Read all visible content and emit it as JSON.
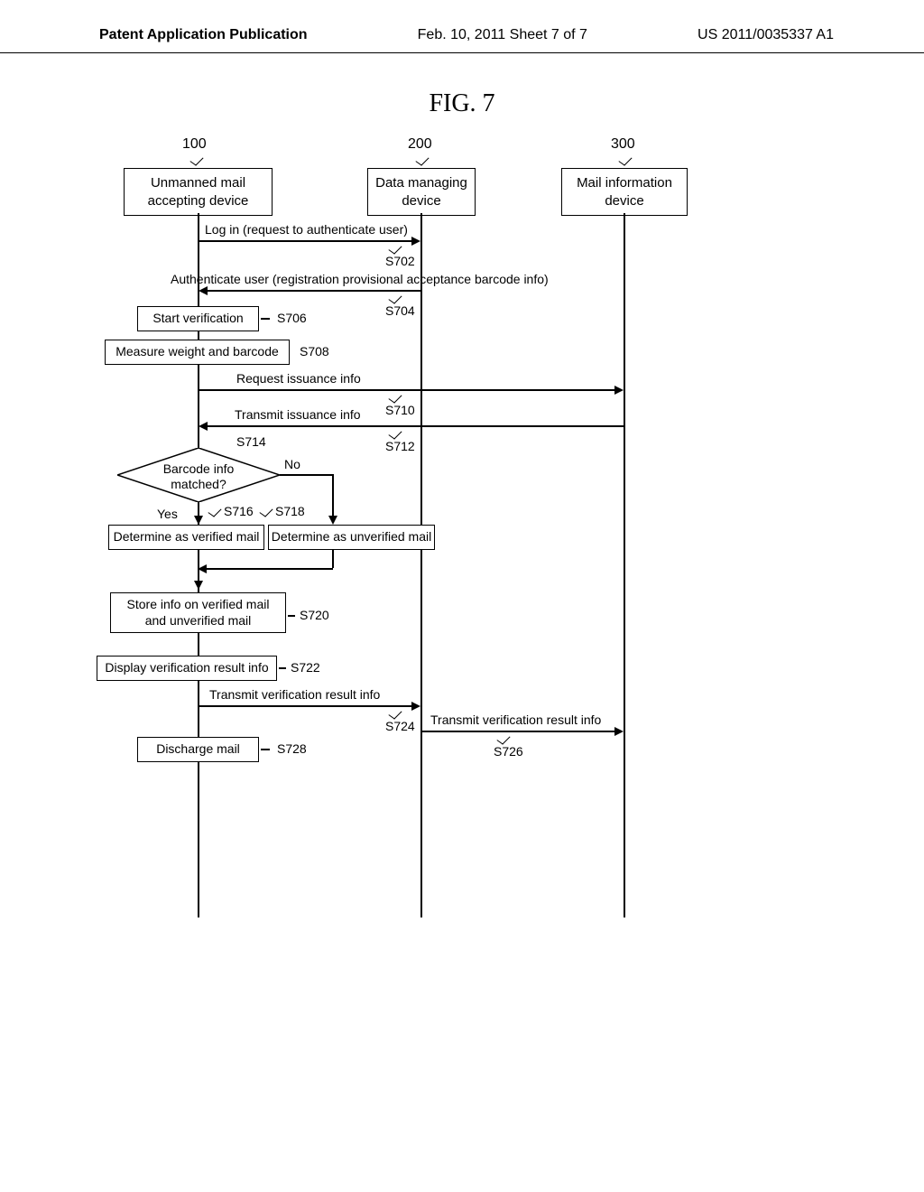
{
  "header": {
    "left": "Patent Application Publication",
    "middle": "Feb. 10, 2011  Sheet 7 of 7",
    "right": "US 2011/0035337 A1"
  },
  "figure_title": "FIG. 7",
  "columns": {
    "c100": {
      "num": "100",
      "label": "Unmanned mail\naccepting device"
    },
    "c200": {
      "num": "200",
      "label": "Data managing\ndevice"
    },
    "c300": {
      "num": "300",
      "label": "Mail information\ndevice"
    }
  },
  "messages": {
    "m702": "Log in (request to authenticate user)",
    "s702": "S702",
    "m704": "Authenticate user (registration provisional acceptance barcode info)",
    "s704": "S704",
    "m710": "Request issuance info",
    "s710": "S710",
    "m712": "Transmit issuance info",
    "s712": "S712",
    "m724": "Transmit verification result info",
    "s724": "S724",
    "m726": "Transmit verification result info",
    "s726": "S726"
  },
  "steps": {
    "b706": "Start verification",
    "s706": "S706",
    "b708": "Measure weight and barcode",
    "s708": "S708",
    "d714": "Barcode info\nmatched?",
    "s714": "S714",
    "b716": "Determine as verified mail",
    "s716": "S716",
    "b718": "Determine as unverified mail",
    "s718": "S718",
    "yes": "Yes",
    "no": "No",
    "b720": "Store info on verified mail\nand unverified mail",
    "s720": "S720",
    "b722": "Display verification result info",
    "s722": "S722",
    "b728": "Discharge mail",
    "s728": "S728"
  }
}
